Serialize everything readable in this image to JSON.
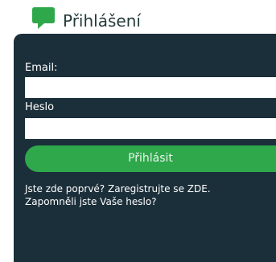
{
  "header": {
    "title": "Přihlášení",
    "logo_icon": "speech-bubble-icon",
    "accent_color": "#2fa84b"
  },
  "form": {
    "email_label": "Email:",
    "email_value": "",
    "password_label": "Heslo",
    "password_value": "",
    "submit_label": "Přihlásit"
  },
  "links": {
    "first_time_question": "Jste zde poprvé?",
    "register_link": "Zaregistrujte se ZDE.",
    "forgot_password_link": "Zapomněli jste Vaše heslo?"
  },
  "colors": {
    "panel_background": "#1b2f3a",
    "button_background": "#2fa84b"
  }
}
